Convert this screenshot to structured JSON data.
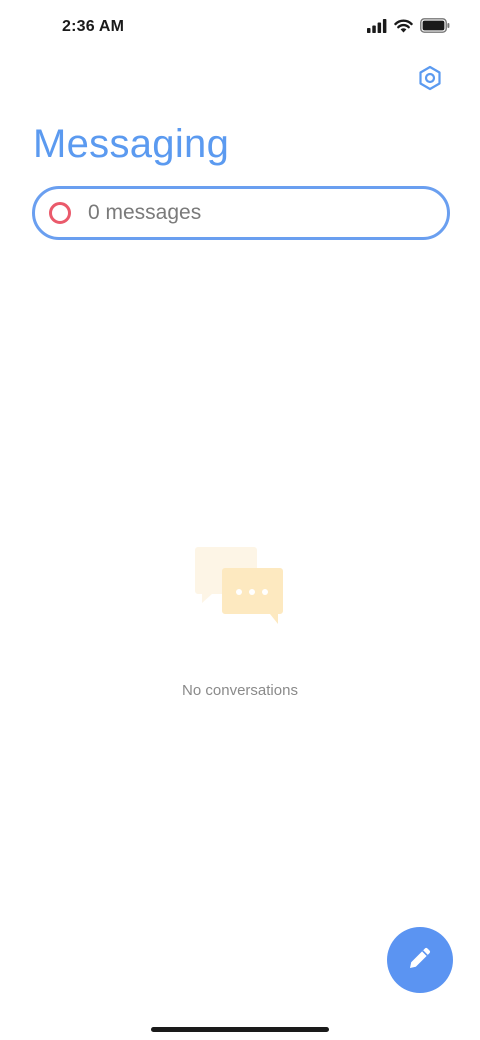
{
  "status_bar": {
    "time": "2:36 AM"
  },
  "header": {
    "title": "Messaging",
    "settings_icon": "hexagon-settings-icon"
  },
  "message_filter": {
    "label": "0 messages",
    "indicator_color": "#ea5a6b"
  },
  "empty_state": {
    "text": "No conversations",
    "icon": "chat-bubbles-icon"
  },
  "fab": {
    "icon": "pencil-icon"
  },
  "colors": {
    "accent": "#5b9af0",
    "fab": "#5b94f2",
    "indicator": "#ea5a6b"
  }
}
